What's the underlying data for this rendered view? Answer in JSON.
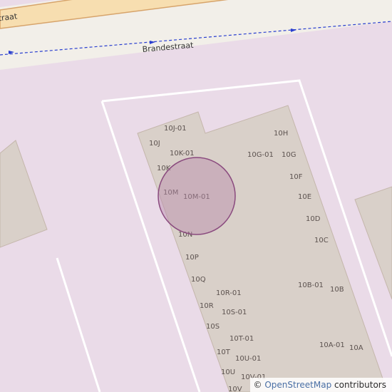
{
  "map": {
    "street_label": "Brandestraat",
    "top_road_label": "traat",
    "building_labels": [
      "10J-01",
      "10J",
      "10K-01",
      "10K",
      "10M",
      "10M-01",
      "10N",
      "10P",
      "10Q",
      "10R-01",
      "10R",
      "10S-01",
      "10S",
      "10T-01",
      "10T",
      "10U-01",
      "10U",
      "10V-01",
      "10V",
      "10H",
      "10G-01",
      "10G",
      "10F",
      "10E",
      "10D",
      "10C",
      "10B-01",
      "10B",
      "10A-01",
      "10A"
    ],
    "colors": {
      "background": "#eadbe8",
      "building_fill": "#d9d0c9",
      "building_stroke": "#c4b6ab",
      "marker_fill": "#b98aab",
      "marker_stroke": "#8a4a7e",
      "road_fill": "#f7deb0",
      "road_casing": "#d7a46b",
      "street_band": "#f2efe9",
      "path_color": "#2a3fcf"
    },
    "attribution": {
      "prefix": "© ",
      "link_text": "OpenStreetMap",
      "suffix": " contributors"
    }
  }
}
